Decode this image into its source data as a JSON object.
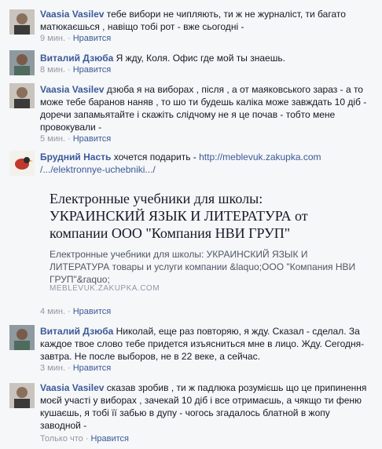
{
  "comments": [
    {
      "author": "Vaasia Vasilev",
      "text": "тебе вибори не чипляють, ти ж не журналіст, ти багато матюкаєшься , навіщо тобі рот - вже сьогодні -",
      "time": "9 мин.",
      "like": "Нравится",
      "avatar": "person-avatar-1"
    },
    {
      "author": "Виталий Дзюба",
      "text": "Я жду, Коля. Офис где мой ты знаешь.",
      "time": "8 мин.",
      "like": "Нравится",
      "avatar": "person-avatar-2"
    },
    {
      "author": "Vaasia Vasilev",
      "text": "дзюба я на виборах , після , а от маяковського зараз - а то може тебе баранов наняв , то шо ти будешь каліка може завждать 10 діб - доречи запамьятайте і скажіть слідчому не я це почав - тобто мене провокували -",
      "time": "5 мин.",
      "like": "Нравится",
      "avatar": "person-avatar-1"
    },
    {
      "author": "Брудний Насть",
      "text": "хочется подарить - ",
      "link1": "http://meblevuk.zakupka.com",
      "link2": "/.../elektronnye-uchebniki.../",
      "time": "4 мин.",
      "like": "Нравится",
      "avatar": "bird-avatar",
      "preview": {
        "title": "Електронные учебники для школы: УКРАИНСКИЙ ЯЗЫК И ЛИТЕРАТУРА от компании ООО \"Компания НВИ ГРУП\"",
        "description": "Електронные учебники для школы: УКРАИНСКИЙ ЯЗЫК И ЛИТЕРАТУРА товары и услуги компании &laquo;ООО \"Компания НВИ ГРУП\"&raquo;",
        "domain": "MEBLEVUK.ZAKUPKA.COM"
      }
    },
    {
      "author": "Виталий Дзюба",
      "text": "Николай, еще раз повторяю, я жду. Сказал - сделал. За каждое твое слово тебе придется изъясниться мне в лицо. Жду. Сегодня-завтра. Не после выборов, не в 22 веке, а сейчас.",
      "time": "3 мин.",
      "like": "Нравится",
      "avatar": "person-avatar-2"
    },
    {
      "author": "Vaasia Vasilev",
      "text": "сказав зробив , ти ж падлюка розумієшь що це припинення моєй участі у виборах , зачекай 10 діб і все отримаєшь, а чякщо ти феню кушаєшь, я тобі її забью в дупу - чогось згадалось блатной в жопу заводной -",
      "time": "Только что",
      "like": "Нравится",
      "avatar": "person-avatar-1"
    }
  ],
  "separator": "·",
  "colors": {
    "link": "#3b5998",
    "meta": "#9197a3",
    "text": "#141823"
  }
}
